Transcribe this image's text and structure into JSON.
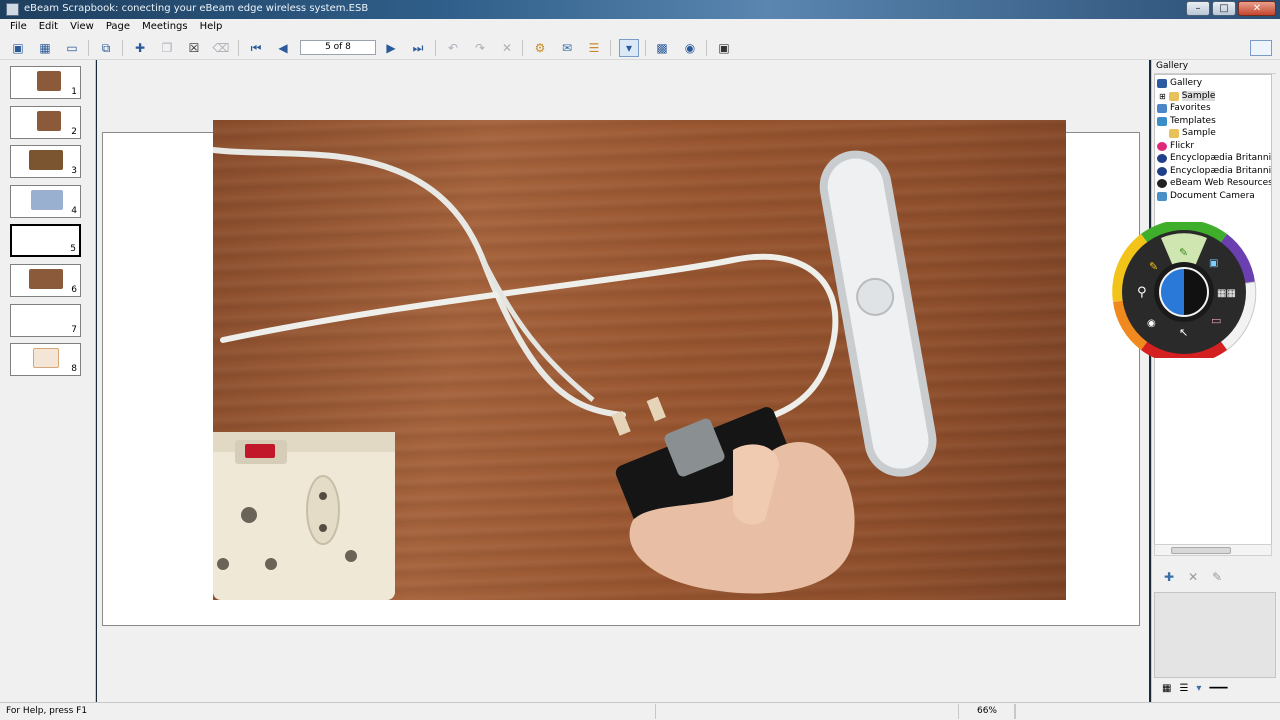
{
  "window": {
    "title": "eBeam Scrapbook: conecting your eBeam edge wireless system.ESB"
  },
  "menu": [
    "File",
    "Edit",
    "View",
    "Page",
    "Meetings",
    "Help"
  ],
  "toolbar": {
    "page_indicator": "5 of 8",
    "icons": [
      "thumbnails-view-icon",
      "grid-view-icon",
      "single-view-icon",
      "fit-page-icon",
      "new-page-icon",
      "duplicate-page-icon",
      "delete-page-icon",
      "clear-page-icon",
      "first-page-icon",
      "prev-page-icon",
      "next-page-icon",
      "last-page-icon",
      "undo-icon",
      "redo-icon",
      "delete-icon",
      "share-icon",
      "send-icon",
      "document-icon",
      "whiteboard-mode-icon",
      "capture-icon",
      "snapshot-icon",
      "camera-icon"
    ]
  },
  "thumbnails": [
    {
      "num": "1",
      "color": "#8a5a3a"
    },
    {
      "num": "2",
      "color": "#8a5a3a"
    },
    {
      "num": "3",
      "color": "#7a5530"
    },
    {
      "num": "4",
      "color": "#9ab0d0"
    },
    {
      "num": "5",
      "color": "#ffffff"
    },
    {
      "num": "6",
      "color": "#8a5a3a"
    },
    {
      "num": "7",
      "color": "#ffffff"
    },
    {
      "num": "8",
      "color": "#d8a878"
    }
  ],
  "active_thumbnail": "5",
  "gallery": {
    "header": "Gallery",
    "items": [
      {
        "label": "Gallery",
        "icon": "gallery-icon",
        "indent": 0
      },
      {
        "label": "Sample",
        "icon": "folder-icon",
        "indent": 2
      },
      {
        "label": "Favorites",
        "icon": "favorites-icon",
        "indent": 0
      },
      {
        "label": "Templates",
        "icon": "templates-icon",
        "indent": 0
      },
      {
        "label": "Sample",
        "icon": "folder-icon",
        "indent": 2
      },
      {
        "label": "Flickr",
        "icon": "flickr-icon",
        "indent": 0
      },
      {
        "label": "Encyclopædia Britannic",
        "icon": "britannica-icon",
        "indent": 0
      },
      {
        "label": "Encyclopædia Britannic",
        "icon": "britannica-icon",
        "indent": 0
      },
      {
        "label": "eBeam Web Resources",
        "icon": "web-resources-icon",
        "indent": 0
      },
      {
        "label": "Document Camera",
        "icon": "document-camera-icon",
        "indent": 0
      }
    ]
  },
  "colors": {
    "accent": "#3a6ea8",
    "wood": "#9a5a33",
    "palette_green": "#3fae2a",
    "palette_purple": "#6a3fb0",
    "palette_orange": "#f08a1e",
    "palette_red": "#d42020",
    "palette_yellow": "#f2c318"
  },
  "status": {
    "help": "For Help, press F1",
    "zoom": "66%"
  }
}
